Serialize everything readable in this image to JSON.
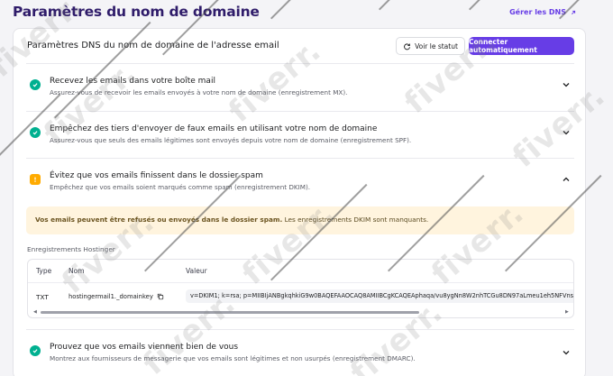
{
  "header": {
    "title": "Paramètres du nom de domaine",
    "manage_dns_label": "Gérer les DNS"
  },
  "card": {
    "title": "Paramètres DNS du nom de domaine de l'adresse email",
    "view_status_label": "Voir le statut",
    "connect_label": "Connecter automatiquement"
  },
  "rows": [
    {
      "title": "Recevez les emails dans votre boîte mail",
      "description": "Assurez-vous de recevoir les emails envoyés à votre nom de domaine (enregistrement MX).",
      "status": "ok"
    },
    {
      "title": "Empêchez des tiers d'envoyer de faux emails en utilisant votre nom de domaine",
      "description": "Assurez-vous que seuls des emails légitimes sont envoyés depuis votre nom de domaine (enregistrement SPF).",
      "status": "ok"
    },
    {
      "title": "Évitez que vos emails finissent dans le dossier spam",
      "description": "Empêchez que vos emails soient marqués comme spam (enregistrement DKIM).",
      "status": "warning"
    },
    {
      "title": "Prouvez que vos emails viennent bien de vous",
      "description": "Montrez aux fournisseurs de messagerie que vos emails sont légitimes et non usurpés (enregistrement DMARC).",
      "status": "ok"
    }
  ],
  "alert": {
    "bold": "Vos emails peuvent être refusés ou envoyés dans le dossier spam.",
    "rest": " Les enregistrements DKIM sont manquants."
  },
  "records": {
    "label": "Enregistrements Hostinger",
    "columns": [
      "Type",
      "Nom",
      "Valeur"
    ],
    "row": {
      "type": "TXT",
      "name": "hostingermail1._domainkey",
      "value": "v=DKIM1; k=rsa; p=MIIBIjANBgkqhkiG9w0BAQEFAAOCAQ8AMIIBCgKCAQEAphaqa/vu8ygNn8W2nhTCGu8DN97aLmeu1eh5NFVnsn"
    }
  },
  "watermark": "fiverr.",
  "colors": {
    "accent": "#673de6",
    "ok": "#00b090",
    "warning": "#ffab00",
    "alert_bg": "#fff4de"
  }
}
